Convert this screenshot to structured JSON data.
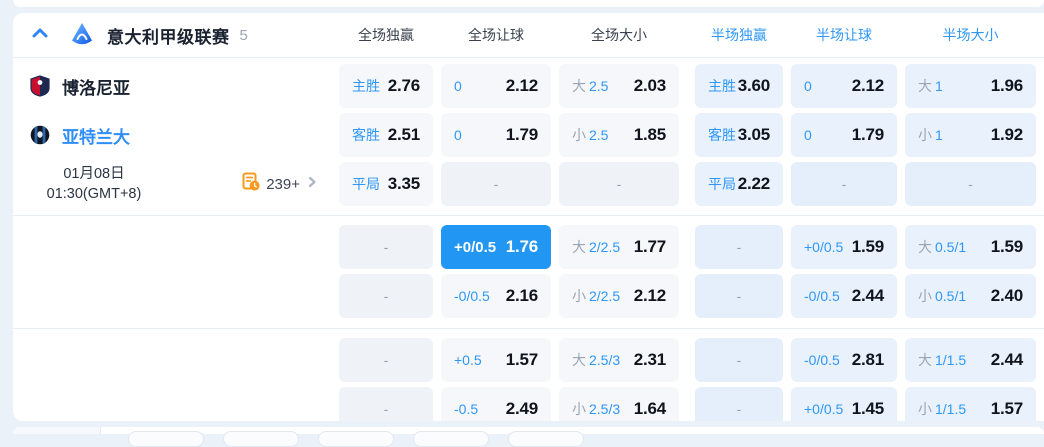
{
  "colors": {
    "accent_blue": "#2e97f8",
    "selected_cell": "#2196f3",
    "value_text": "#10151d",
    "muted_gray": "#9aa5b3",
    "icon_orange": "#f79a1f",
    "page_bg": "#eaf1f9"
  },
  "ui": {
    "dash": "-"
  },
  "league_header": {
    "name": "意大利甲级联赛",
    "match_count": "5"
  },
  "column_headers": [
    {
      "label": "全场独赢",
      "scope": "full"
    },
    {
      "label": "全场让球",
      "scope": "full"
    },
    {
      "label": "全场大小",
      "scope": "full"
    },
    {
      "label": "半场独赢",
      "scope": "half"
    },
    {
      "label": "半场让球",
      "scope": "half"
    },
    {
      "label": "半场大小",
      "scope": "half"
    }
  ],
  "match": {
    "home_team": "博洛尼亚",
    "away_team": "亚特兰大",
    "date": "01月08日",
    "time": "01:30(GMT+8)",
    "more_odds_count": "239+"
  },
  "odds_rows": [
    {
      "section": 1,
      "left": "home",
      "cells": [
        {
          "type": "outcome",
          "label": "主胜",
          "value": "2.76"
        },
        {
          "type": "handicap",
          "label": "0",
          "value": "2.12"
        },
        {
          "type": "overunder",
          "side": "大",
          "line": "2.5",
          "value": "2.03"
        },
        {
          "type": "outcome",
          "label": "主胜",
          "value": "3.60"
        },
        {
          "type": "handicap",
          "label": "0",
          "value": "2.12"
        },
        {
          "type": "overunder",
          "side": "大",
          "line": "1",
          "value": "1.96"
        }
      ]
    },
    {
      "section": 1,
      "left": "away",
      "cells": [
        {
          "type": "outcome",
          "label": "客胜",
          "value": "2.51"
        },
        {
          "type": "handicap",
          "label": "0",
          "value": "1.79"
        },
        {
          "type": "overunder",
          "side": "小",
          "line": "2.5",
          "value": "1.85"
        },
        {
          "type": "outcome",
          "label": "客胜",
          "value": "3.05"
        },
        {
          "type": "handicap",
          "label": "0",
          "value": "1.79"
        },
        {
          "type": "overunder",
          "side": "小",
          "line": "1",
          "value": "1.92"
        }
      ]
    },
    {
      "section": 1,
      "left": "datetime",
      "cells": [
        {
          "type": "outcome",
          "label": "平局",
          "value": "3.35"
        },
        {
          "type": "empty"
        },
        {
          "type": "empty"
        },
        {
          "type": "outcome",
          "label": "平局",
          "value": "2.22"
        },
        {
          "type": "empty"
        },
        {
          "type": "empty"
        }
      ]
    },
    {
      "section": 2,
      "cells": [
        {
          "type": "empty"
        },
        {
          "type": "handicap",
          "label": "+0/0.5",
          "value": "1.76",
          "selected": true
        },
        {
          "type": "overunder",
          "side": "大",
          "line": "2/2.5",
          "value": "1.77"
        },
        {
          "type": "empty"
        },
        {
          "type": "handicap",
          "label": "+0/0.5",
          "value": "1.59"
        },
        {
          "type": "overunder",
          "side": "大",
          "line": "0.5/1",
          "value": "1.59"
        }
      ]
    },
    {
      "section": 2,
      "cells": [
        {
          "type": "empty"
        },
        {
          "type": "handicap",
          "label": "-0/0.5",
          "value": "2.16"
        },
        {
          "type": "overunder",
          "side": "小",
          "line": "2/2.5",
          "value": "2.12"
        },
        {
          "type": "empty"
        },
        {
          "type": "handicap",
          "label": "-0/0.5",
          "value": "2.44"
        },
        {
          "type": "overunder",
          "side": "小",
          "line": "0.5/1",
          "value": "2.40"
        }
      ]
    },
    {
      "section": 3,
      "cells": [
        {
          "type": "empty"
        },
        {
          "type": "handicap",
          "label": "+0.5",
          "value": "1.57"
        },
        {
          "type": "overunder",
          "side": "大",
          "line": "2.5/3",
          "value": "2.31"
        },
        {
          "type": "empty"
        },
        {
          "type": "handicap",
          "label": "-0/0.5",
          "value": "2.81"
        },
        {
          "type": "overunder",
          "side": "大",
          "line": "1/1.5",
          "value": "2.44"
        }
      ]
    },
    {
      "section": 3,
      "cells": [
        {
          "type": "empty"
        },
        {
          "type": "handicap",
          "label": "-0.5",
          "value": "2.49"
        },
        {
          "type": "overunder",
          "side": "小",
          "line": "2.5/3",
          "value": "1.64"
        },
        {
          "type": "empty"
        },
        {
          "type": "handicap",
          "label": "+0/0.5",
          "value": "1.45"
        },
        {
          "type": "overunder",
          "side": "小",
          "line": "1/1.5",
          "value": "1.57"
        }
      ]
    }
  ]
}
